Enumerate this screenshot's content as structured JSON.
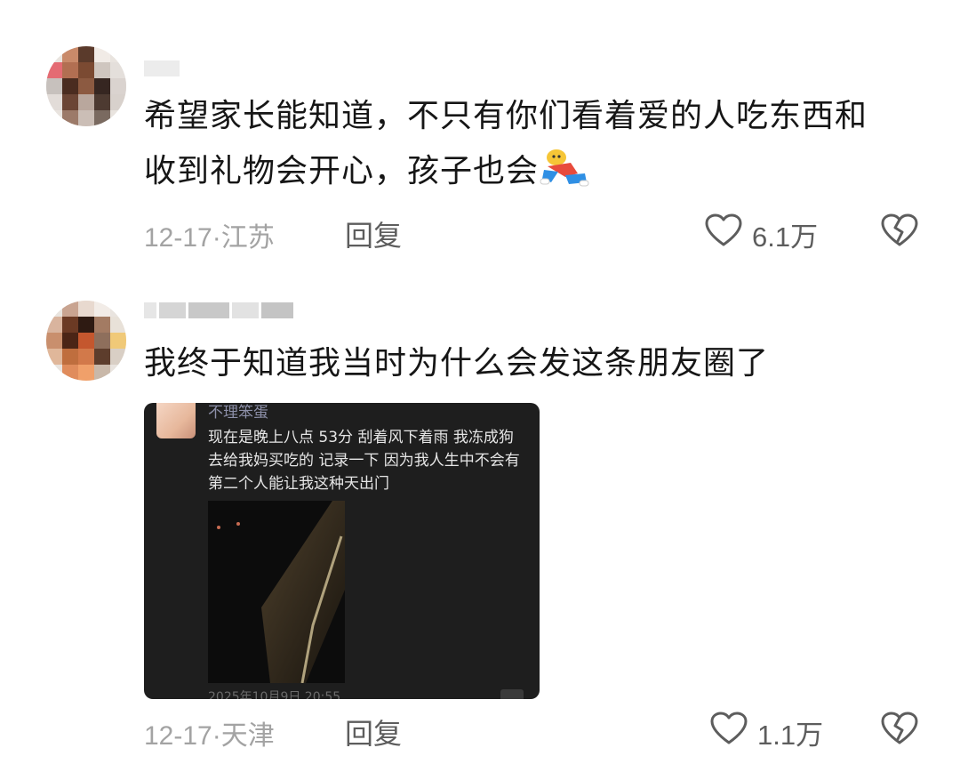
{
  "comments": [
    {
      "text_line1": "希望家长能知道，不只有你们看着爱的人吃东西和",
      "text_line2": "收到礼物会开心，孩子也会",
      "sticker": "running-doll-sticker",
      "date": "12-17",
      "separator": "·",
      "location": "江苏",
      "reply_label": "回复",
      "like_count": "6.1万"
    },
    {
      "text_line1": "我终于知道我当时为什么会发这条朋友圈了",
      "date": "12-17",
      "separator": "·",
      "location": "天津",
      "reply_label": "回复",
      "like_count": "1.1万",
      "embedded_moment": {
        "name": "不理笨蛋",
        "text": "现在是晚上八点 53分  刮着风下着雨  我冻成狗去给我妈买吃的  记录一下  因为我人生中不会有第二个人能让我这种天出门",
        "footer": "2025年10月9日 20:55"
      }
    }
  ],
  "icons": {
    "like": "heart-outline-icon",
    "dislike": "broken-heart-icon"
  },
  "colors": {
    "text_primary": "#161616",
    "text_meta": "#a3a3a3",
    "text_action": "#5d5d5d",
    "card_bg": "#1e1e1e"
  }
}
